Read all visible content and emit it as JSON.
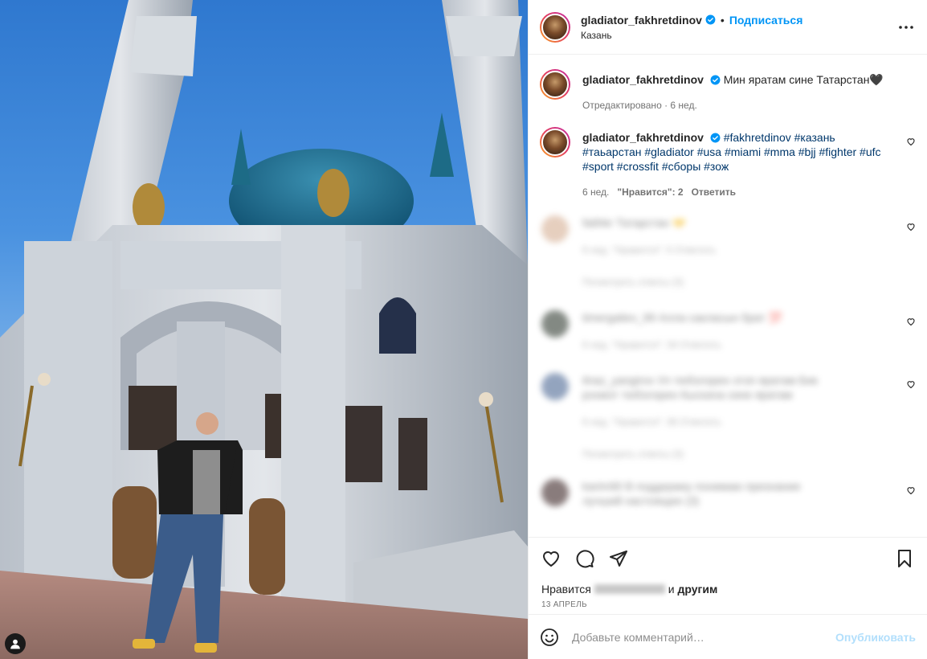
{
  "colors": {
    "accent": "#0095f6",
    "hashtag": "#00376b",
    "muted": "#737373"
  },
  "header": {
    "username": "gladiator_fakhretdinov",
    "separator": "•",
    "follow_label": "Подписаться",
    "location": "Казань"
  },
  "caption": {
    "username": "gladiator_fakhretdinov",
    "text": "Мин яратам сине Татарстан🖤",
    "meta": "Отредактировано · 6 нед."
  },
  "comments": [
    {
      "username": "gladiator_fakhretdinov",
      "hashtags": "#fakhretdinov #казань #таьарстан #gladiator #usa #miami #mma #bjj #fighter #ufc #sport #crossfit #сборы #зож",
      "time": "6 нед.",
      "likes": "\"Нравится\": 2",
      "reply": "Ответить"
    },
    {
      "text": "fatihkr Татарстан 🤝",
      "meta": "6 нед. \"Нравится\": 5 Ответить",
      "replies": "Посмотреть ответы (3)"
    },
    {
      "text": "timergaliev_99 Алла сакласын брат 💯",
      "meta": "6 нед. \"Нравится\": 34 Ответить"
    },
    {
      "text": "ilnaz_yangirov Ул тюбэлэрен этэп яратам Бик рэхмэт тюбэлэрен Кыскача сине яратам",
      "meta": "6 нед. \"Нравится\": 36 Ответить",
      "replies": "Посмотреть ответы (3)"
    },
    {
      "text": "karim90 В поддержку понимаю признание",
      "meta": "лучший настоящее (3)"
    }
  ],
  "actions": {
    "likes_prefix": "Нравится",
    "likes_and": "и",
    "likes_suffix": "другим",
    "date": "13 АПРЕЛЬ"
  },
  "add_comment": {
    "placeholder": "Добавьте комментарий…",
    "publish_label": "Опубликовать"
  }
}
